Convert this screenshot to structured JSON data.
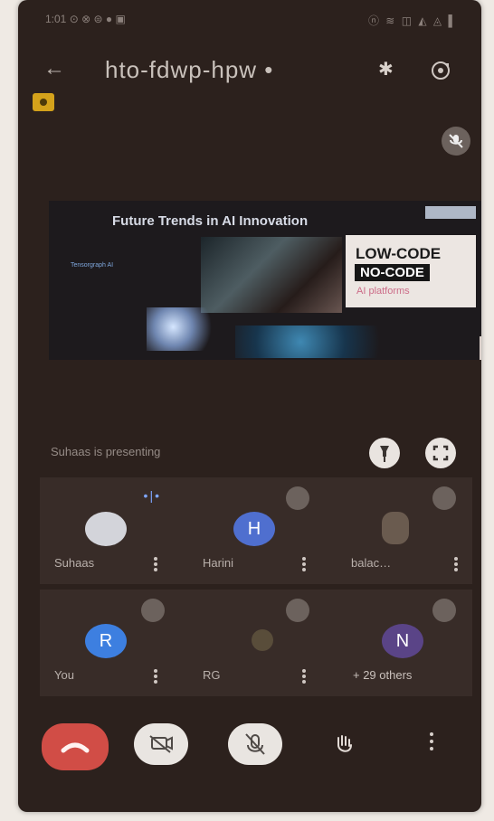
{
  "status": {
    "left": "1:01 ⊙ ⊗ ⊜ ● ▣",
    "right": "ⓝ ≋ ◫ ◭ ◬ ▌"
  },
  "meeting": {
    "back_icon": "←",
    "title": "hto-fdwp-hpw •",
    "bluetooth_icon": "bluetooth-icon",
    "flip_icon": "switch-camera-icon",
    "record_badge_color": "#d4a21b"
  },
  "slide": {
    "title": "Future Trends in AI Innovation",
    "brand": "Tensorgraph AI",
    "low_code": "LOW-CODE",
    "no_code": "NO-CODE",
    "platform": "AI platforms"
  },
  "presenting": {
    "text": "Suhaas is presenting",
    "pin_icon": "pin-icon",
    "fullscreen_icon": "fullscreen-icon"
  },
  "participants": [
    {
      "name": "Suhaas",
      "avatar_text": "",
      "avatar_color": "#c9cad2"
    },
    {
      "name": "Harini",
      "avatar_text": "H",
      "avatar_color": "#4f6fcf"
    },
    {
      "name": "balac…",
      "avatar_text": "",
      "avatar_color": "#6a5b4f"
    },
    {
      "name": "You",
      "avatar_text": "R",
      "avatar_color": "#3d7fe0"
    },
    {
      "name": "RG",
      "avatar_text": "",
      "avatar_color": "#594d3a"
    },
    {
      "name": "+ 29 others",
      "avatar_text": "N",
      "avatar_color": "#5a4487"
    }
  ],
  "controls": {
    "hangup_icon": "end-call-icon",
    "video_off_icon": "video-off-icon",
    "mic_off_icon": "mic-off-icon",
    "hand_icon": "raise-hand-icon",
    "more_icon": "more-options-icon"
  },
  "accent_red": "#d14d46"
}
